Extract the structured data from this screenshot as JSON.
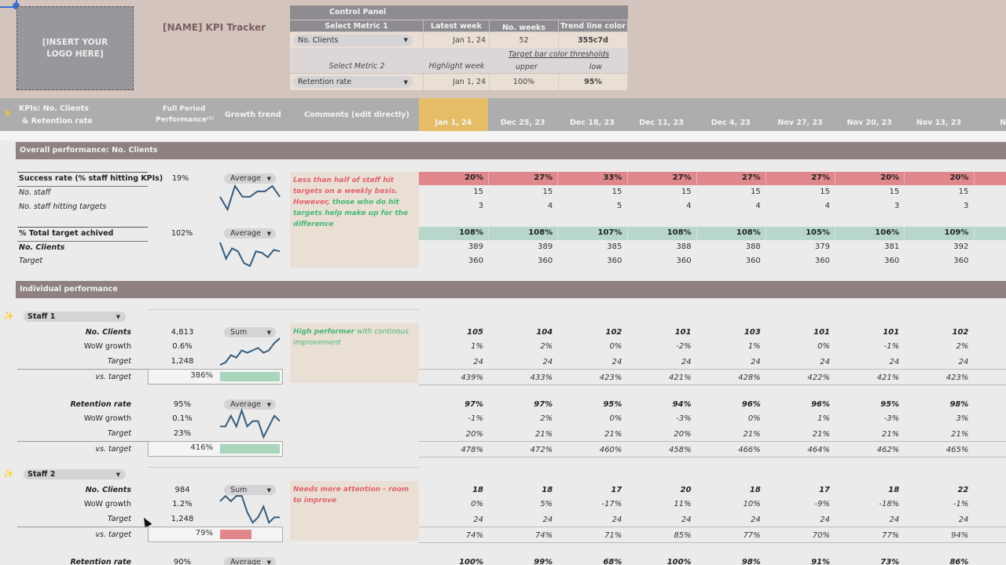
{
  "header": {
    "logo_placeholder": "[INSERT YOUR LOGO HERE]",
    "title": "[NAME] KPI Tracker"
  },
  "control_panel": {
    "title": "Control Panel",
    "headers": [
      "Select Metric 1",
      "Latest week",
      "No. weeks",
      "Trend line color"
    ],
    "metric1": "No. Clients",
    "latest_week": "Jan 1, 24",
    "no_weeks": "52",
    "trend_line_color": "355c7d",
    "thresholds_label": "Target bar color thresholds",
    "metric2_label": "Select Metric 2",
    "highlight_week_label": "Highlight week",
    "upper_label": "upper",
    "low_label": "low",
    "metric2": "Retention rate",
    "highlight_week": "Jan 1, 24",
    "upper": "100%",
    "low": "95%"
  },
  "columns": {
    "kpi_title_line1": "KPIs: No. Clients",
    "kpi_title_line2": "& Retention rate",
    "full_period_line1": "Full Period",
    "full_period_line2": "Performance⁽¹⁾",
    "growth_trend": "Growth trend",
    "comments": "Comments (edit directly)",
    "dates": [
      "Jan 1, 24",
      "Dec 25, 23",
      "Dec 18, 23",
      "Dec 11, 23",
      "Dec 4, 23",
      "Nov 27, 23",
      "Nov 20, 23",
      "Nov 13, 23",
      "Nov"
    ]
  },
  "colors": {
    "trend_line": "#355c7d",
    "highlight": "#e6bd67",
    "bad": "#e0878c",
    "good": "#a9d5bd"
  },
  "overall": {
    "section_title": "Overall performance: No. Clients",
    "success": {
      "label": "Success rate (% staff hitting KPIs)",
      "full": "19%",
      "agg": "Average",
      "values": [
        "20%",
        "27%",
        "33%",
        "27%",
        "27%",
        "27%",
        "20%",
        "20%"
      ],
      "sub": [
        {
          "label": "No. staff",
          "values": [
            "15",
            "15",
            "15",
            "15",
            "15",
            "15",
            "15",
            "15"
          ]
        },
        {
          "label": "No. staff hitting targets",
          "values": [
            "3",
            "4",
            "5",
            "4",
            "4",
            "4",
            "3",
            "3"
          ]
        }
      ],
      "trend": [
        27,
        20,
        33,
        27,
        27,
        30,
        30,
        33,
        27
      ]
    },
    "total": {
      "label": "% Total target achived",
      "full": "102%",
      "agg": "Average",
      "values": [
        "108%",
        "108%",
        "107%",
        "108%",
        "108%",
        "105%",
        "106%",
        "109%"
      ],
      "sub": [
        {
          "label": "No. Clients",
          "values": [
            "389",
            "389",
            "385",
            "388",
            "388",
            "379",
            "381",
            "392"
          ]
        },
        {
          "label": "Target",
          "values": [
            "360",
            "360",
            "360",
            "360",
            "360",
            "360",
            "360",
            "360"
          ]
        }
      ],
      "trend": [
        392,
        381,
        388,
        386,
        378,
        376,
        386,
        385,
        382,
        387,
        386
      ]
    },
    "comment_red": "Less than half of staff hit targets on a weekly basis. However,",
    "comment_green": "those who do hit targets help make up for the difference"
  },
  "individual": {
    "section_title": "Individual performance",
    "staff": [
      {
        "name": "Staff 1",
        "comment_bold": "High performer",
        "comment_rest": "with continous improvement",
        "comment_color": "green",
        "metrics": [
          {
            "label": "No. Clients",
            "full": "4,813",
            "agg": "Sum",
            "wow_label": "WoW growth",
            "wow_full": "0.6%",
            "target_label": "Target",
            "target_full": "1,248",
            "vs_label": "vs. target",
            "vs_full": "386%",
            "vs_fill": 1.0,
            "vs_color": "good",
            "values": [
              "105",
              "104",
              "102",
              "101",
              "103",
              "101",
              "101",
              "102"
            ],
            "wow": [
              "1%",
              "2%",
              "0%",
              "-2%",
              "1%",
              "0%",
              "-1%",
              "2%"
            ],
            "target": [
              "24",
              "24",
              "24",
              "24",
              "24",
              "24",
              "24",
              "24"
            ],
            "vs": [
              "439%",
              "433%",
              "423%",
              "421%",
              "428%",
              "422%",
              "421%",
              "423%"
            ],
            "trend": [
              95,
              96,
              99,
              98,
              101,
              100,
              101,
              102,
              100,
              101,
              104,
              106
            ]
          },
          {
            "label": "Retention rate",
            "full": "95%",
            "agg": "Average",
            "wow_label": "WoW growth",
            "wow_full": "0.1%",
            "target_label": "Target",
            "target_full": "23%",
            "vs_label": "vs. target",
            "vs_full": "416%",
            "vs_fill": 1.0,
            "vs_color": "good",
            "values": [
              "97%",
              "97%",
              "95%",
              "94%",
              "96%",
              "96%",
              "95%",
              "98%"
            ],
            "wow": [
              "-1%",
              "2%",
              "0%",
              "-3%",
              "0%",
              "1%",
              "-3%",
              "3%"
            ],
            "target": [
              "20%",
              "21%",
              "21%",
              "20%",
              "21%",
              "21%",
              "21%",
              "21%"
            ],
            "vs": [
              "478%",
              "472%",
              "460%",
              "458%",
              "466%",
              "464%",
              "462%",
              "465%"
            ],
            "trend": [
              95,
              95,
              97,
              95,
              98,
              95,
              96,
              96,
              93,
              95,
              97,
              96
            ]
          }
        ]
      },
      {
        "name": "Staff 2",
        "comment_bold": "Needs more attention - room to improve",
        "comment_rest": "",
        "comment_color": "red",
        "metrics": [
          {
            "label": "No. Clients",
            "full": "984",
            "agg": "Sum",
            "wow_label": "WoW growth",
            "wow_full": "1.2%",
            "target_label": "Target",
            "target_full": "1,248",
            "vs_label": "vs. target",
            "vs_full": "79%",
            "vs_fill": 0.52,
            "vs_color": "bad",
            "values": [
              "18",
              "18",
              "17",
              "20",
              "18",
              "17",
              "18",
              "22"
            ],
            "wow": [
              "0%",
              "5%",
              "-17%",
              "11%",
              "10%",
              "-9%",
              "-18%",
              "-1%"
            ],
            "target": [
              "24",
              "24",
              "24",
              "24",
              "24",
              "24",
              "24",
              "24"
            ],
            "vs": [
              "74%",
              "74%",
              "71%",
              "85%",
              "77%",
              "70%",
              "77%",
              "94%"
            ],
            "trend": [
              21,
              22,
              21,
              22,
              22,
              19,
              17,
              18,
              20,
              17,
              18,
              18
            ]
          },
          {
            "label": "Retention rate",
            "full": "90%",
            "agg": "Average",
            "values": [
              "100%",
              "99%",
              "68%",
              "100%",
              "98%",
              "91%",
              "73%",
              "86%"
            ]
          }
        ]
      }
    ]
  }
}
